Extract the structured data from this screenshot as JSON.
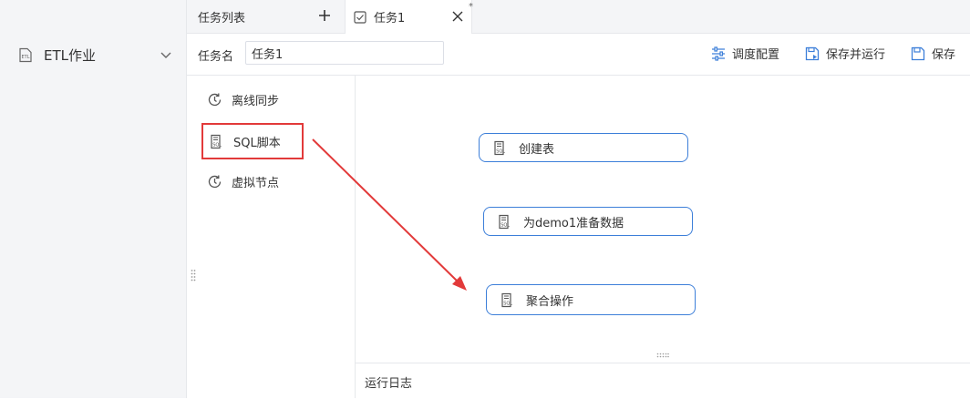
{
  "sidebar": {
    "item": {
      "label": "ETL作业",
      "icon": "etl-file-icon",
      "chevron": "chevron-down-icon"
    }
  },
  "tabs": {
    "list_label": "任务列表",
    "add_icon": "plus-icon",
    "active": {
      "label": "任务1",
      "icon": "task-check-icon",
      "modified_marker": "*",
      "close_icon": "close-icon"
    }
  },
  "toolbar": {
    "task_name_label": "任务名",
    "task_name_value": "任务1",
    "schedule_label": "调度配置",
    "save_run_label": "保存并运行",
    "save_label": "保存"
  },
  "node_panel": {
    "items": [
      {
        "label": "离线同步",
        "icon": "sync-icon"
      },
      {
        "label": "SQL脚本",
        "icon": "sql-script-icon",
        "highlighted": true
      },
      {
        "label": "虚拟节点",
        "icon": "virtual-node-icon"
      }
    ]
  },
  "canvas": {
    "nodes": [
      {
        "label": "创建表",
        "icon": "sql-script-icon"
      },
      {
        "label": "为demo1准备数据",
        "icon": "sql-script-icon"
      },
      {
        "label": "聚合操作",
        "icon": "sql-script-icon"
      }
    ]
  },
  "log": {
    "label": "运行日志"
  },
  "colors": {
    "accent": "#3d7fd9",
    "highlight": "#e23a3a",
    "sidebar_bg": "#f4f5f7"
  }
}
